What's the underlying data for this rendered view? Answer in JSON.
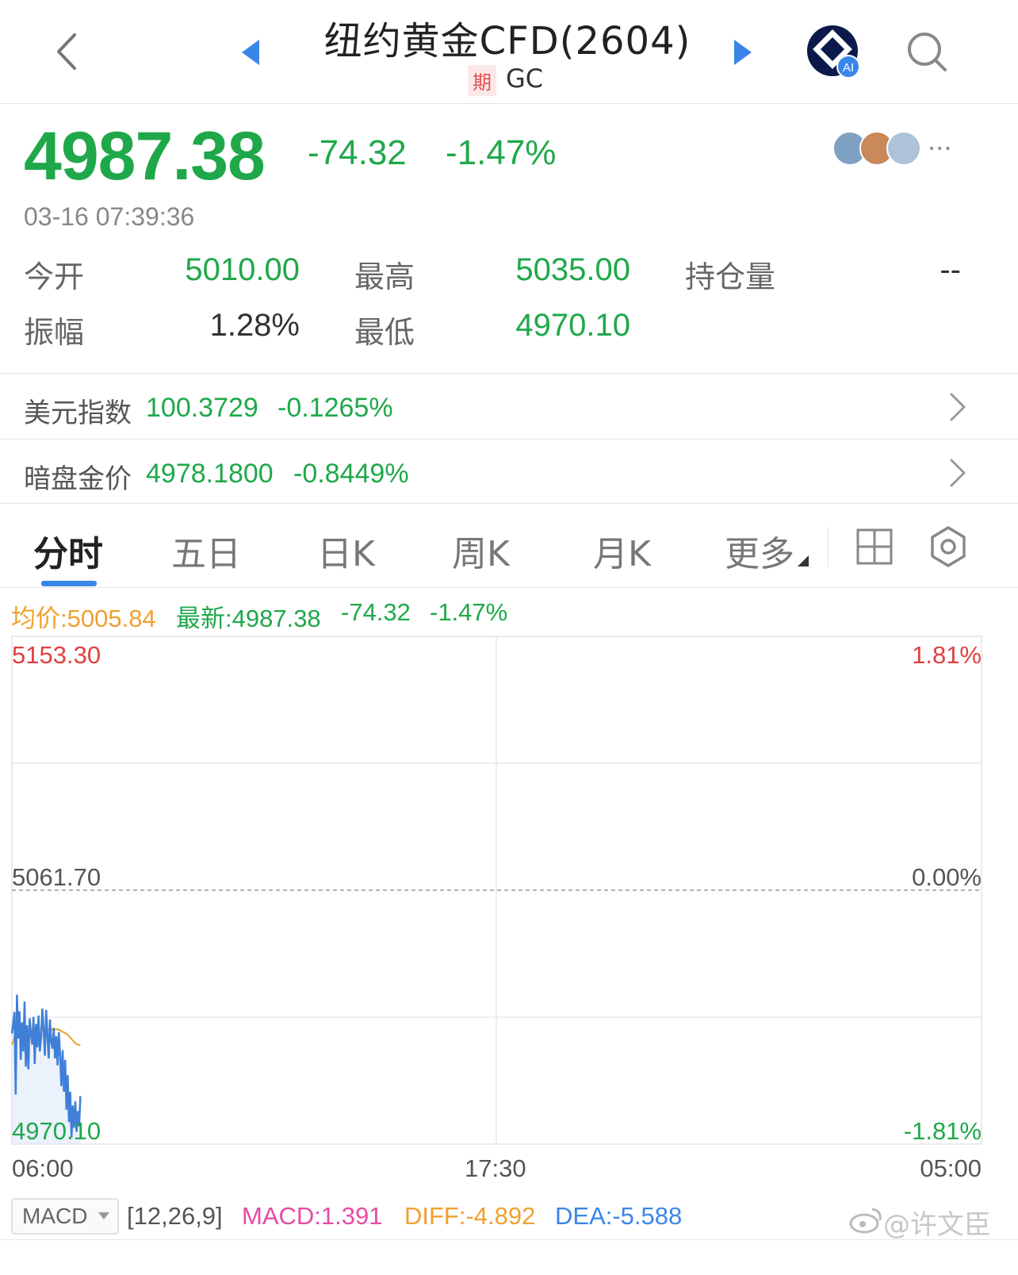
{
  "header": {
    "title": "纽约黄金CFD(2604)",
    "badge": "期",
    "symbol": "GC",
    "ai_badge": "AI"
  },
  "quote": {
    "price": "4987.38",
    "change": "-74.32",
    "change_pct": "-1.47%",
    "timestamp": "03-16 07:39:36",
    "more": "···"
  },
  "stats": {
    "open_label": "今开",
    "open_value": "5010.00",
    "high_label": "最高",
    "high_value": "5035.00",
    "oi_label": "持仓量",
    "oi_value": "--",
    "amp_label": "振幅",
    "amp_value": "1.28%",
    "low_label": "最低",
    "low_value": "4970.10"
  },
  "related": [
    {
      "label": "美元指数",
      "value": "100.3729",
      "pct": "-0.1265%"
    },
    {
      "label": "暗盘金价",
      "value": "4978.1800",
      "pct": "-0.8449%"
    }
  ],
  "tabs": [
    "分时",
    "五日",
    "日K",
    "周K",
    "月K",
    "更多"
  ],
  "legend": {
    "avg": "均价:5005.84",
    "latest": "最新:4987.38",
    "change": "-74.32",
    "pct": "-1.47%"
  },
  "chart_axes": {
    "y_top": "5153.30",
    "y_mid": "5061.70",
    "y_bottom": "4970.10",
    "pct_top": "1.81%",
    "pct_mid": "0.00%",
    "pct_bottom": "-1.81%",
    "x_start": "06:00",
    "x_mid": "17:30",
    "x_end": "05:00"
  },
  "macd": {
    "selector": "MACD",
    "params": "[12,26,9]",
    "macd": "MACD:1.391",
    "diff": "DIFF:-4.892",
    "dea": "DEA:-5.588"
  },
  "watermark": "@许文臣",
  "colors": {
    "down": "#1fa84a",
    "up": "#e04040",
    "price_line": "#3f7fd8",
    "avg_line": "#f0a030",
    "accent": "#3a86e8"
  },
  "chart_data": {
    "type": "line",
    "ylim": [
      4970.1,
      5153.3
    ],
    "x_range": [
      "06:00",
      "05:00"
    ],
    "series": [
      {
        "name": "price",
        "values": [
          5010.0,
          5013.5,
          5017.8,
          4988.0,
          5024.0,
          5008.2,
          5018.0,
          5000.5,
          5014.0,
          5003.5,
          5021.5,
          4998.0,
          5013.0,
          4997.0,
          5015.5,
          5010.0,
          5006.0,
          5016.0,
          4999.0,
          5013.5,
          5005.0,
          5016.5,
          5003.5,
          5008.5,
          5019.0,
          5011.5,
          5002.0,
          5018.5,
          5009.5,
          5001.0,
          5015.0,
          5007.0,
          5004.5,
          5012.0,
          5001.0,
          5009.0,
          4998.5,
          5010.5,
          5002.0,
          4991.0,
          5004.0,
          4989.0,
          5000.5,
          4982.5,
          4995.0,
          4978.0,
          4989.0,
          4972.5,
          4984.0,
          4976.0,
          4985.5,
          4974.5,
          4982.0,
          4976.5,
          4987.4
        ]
      },
      {
        "name": "avg",
        "values": [
          5006.0,
          5007.0,
          5008.5,
          5008.0,
          5009.0,
          5009.5,
          5010.0,
          5010.0,
          5010.5,
          5010.5,
          5011.0,
          5011.0,
          5011.0,
          5011.0,
          5011.0,
          5011.0,
          5011.0,
          5011.5,
          5011.5,
          5011.5,
          5011.5,
          5011.5,
          5011.5,
          5011.5,
          5011.5,
          5011.5,
          5011.5,
          5011.5,
          5011.5,
          5011.5,
          5011.5,
          5011.5,
          5011.5,
          5011.5,
          5011.5,
          5011.5,
          5011.5,
          5011.5,
          5011.0,
          5011.0,
          5010.5,
          5010.5,
          5010.0,
          5010.0,
          5009.5,
          5009.0,
          5008.5,
          5008.0,
          5007.5,
          5007.0,
          5006.5,
          5006.2,
          5006.0,
          5005.9,
          5005.84
        ]
      }
    ]
  }
}
